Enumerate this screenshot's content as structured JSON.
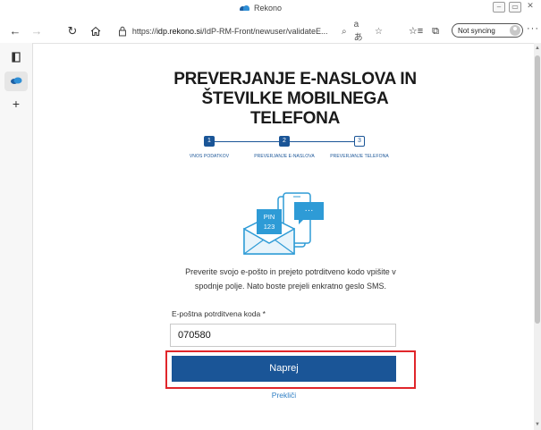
{
  "window": {
    "title": "Rekono",
    "ctrl_minimize": "–",
    "ctrl_restore": "▭",
    "ctrl_close": "✕"
  },
  "toolbar": {
    "url_prefix": "https://",
    "url_host": "idp.rekono.si",
    "url_path": "/IdP-RM-Front/newuser/validateE...",
    "sync_label": "Not syncing",
    "more_label": "···"
  },
  "page": {
    "title_line1": "PREVERJANJE E-NASLOVA IN",
    "title_line2": "ŠTEVILKE MOBILNEGA",
    "title_line3": "TELEFONA",
    "steps": [
      {
        "number": "1",
        "label": "VNOS PODATKOV",
        "status": "done"
      },
      {
        "number": "2",
        "label": "PREVERJANJE E-NASLOVA",
        "status": "done"
      },
      {
        "number": "3",
        "label": "PREVERJANJE TELEFONA",
        "status": "todo"
      }
    ],
    "illustration": {
      "pin_line1": "PIN",
      "pin_line2": "123",
      "bubble": "···"
    },
    "instructions_line1": "Preverite svojo e-pošto in prejeto potrditveno kodo vpišite v",
    "instructions_line2": "spodnje polje. Nato boste prejeli enkratno geslo SMS.",
    "code_label": "E-poštna potrditvena koda *",
    "code_value": "070580",
    "submit_label": "Naprej",
    "cancel_label": "Prekliči"
  },
  "colors": {
    "brand_blue": "#1a5597",
    "link_blue": "#2f7fc4",
    "highlight_red": "#e0262b",
    "illustration_blue": "#2e9bd6"
  }
}
